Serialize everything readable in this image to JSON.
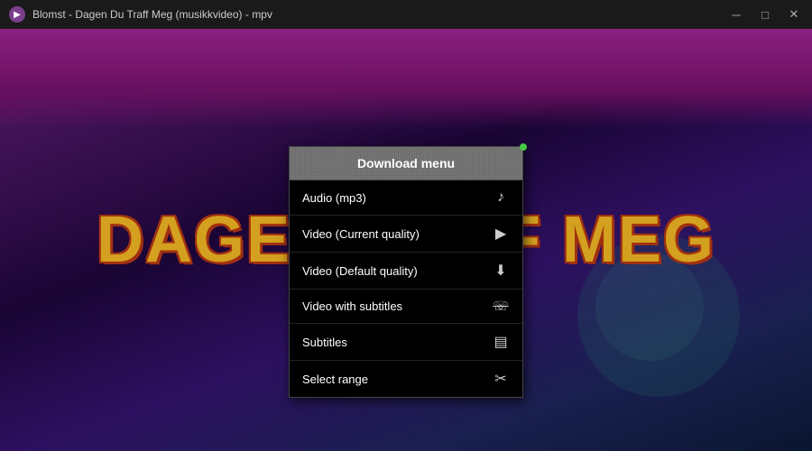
{
  "titlebar": {
    "icon_label": "▶",
    "title": "Blomst - Dagen Du Traff Meg (musikkvideo) - mpv",
    "minimize_label": "─",
    "maximize_label": "□",
    "close_label": "✕"
  },
  "video": {
    "text": "DAGEN         FF MEG"
  },
  "menu": {
    "header": "Download menu",
    "items": [
      {
        "label": "Audio (mp3)",
        "icon": "♪"
      },
      {
        "label": "Video (Current quality)",
        "icon": "▶"
      },
      {
        "label": "Video (Default quality)",
        "icon": "⬇"
      },
      {
        "label": "Video with subtitles",
        "icon": "⌀"
      },
      {
        "label": "Subtitles",
        "icon": "▤"
      },
      {
        "label": "Select range",
        "icon": "✂"
      }
    ]
  }
}
